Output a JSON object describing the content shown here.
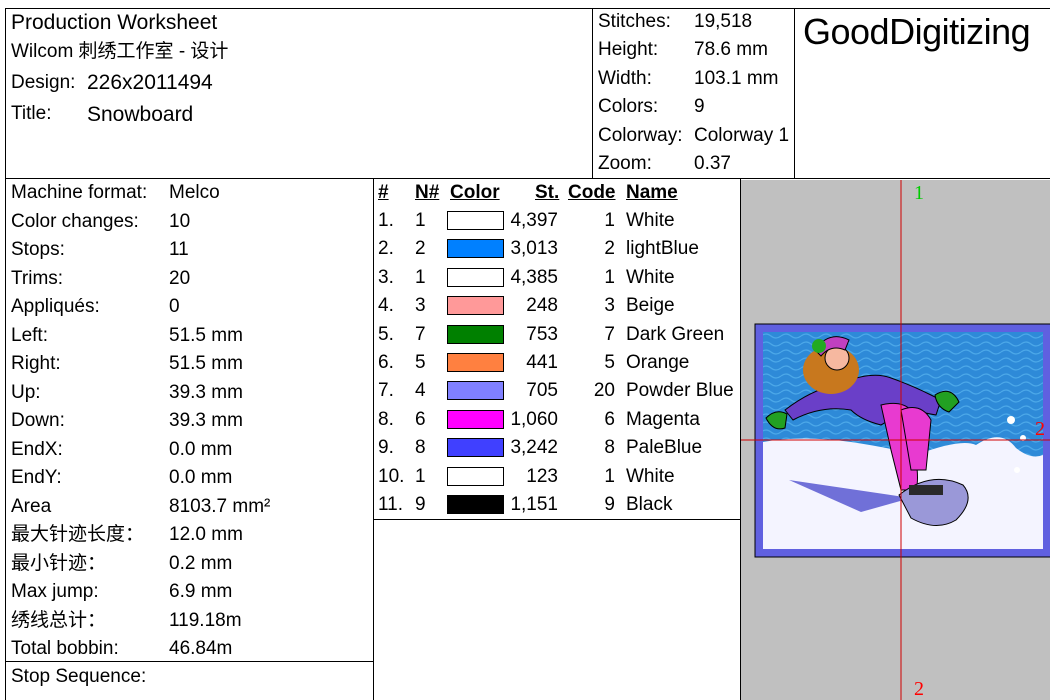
{
  "header": {
    "title": "Production Worksheet",
    "software": "Wilcom 刺绣工作室 - 设计",
    "design_label": "Design:",
    "design_value": "226x2011494",
    "title_label": "Title:",
    "title_value": "Snowboard"
  },
  "stats": [
    {
      "label": "Stitches:",
      "value": "19,518"
    },
    {
      "label": "Height:",
      "value": "78.6 mm"
    },
    {
      "label": "Width:",
      "value": "103.1 mm"
    },
    {
      "label": "Colors:",
      "value": "9"
    },
    {
      "label": "Colorway:",
      "value": "Colorway 1"
    },
    {
      "label": "Zoom:",
      "value": "0.37"
    }
  ],
  "brand": "GoodDigitizing",
  "machine": [
    {
      "label": "Machine format:",
      "value": "Melco"
    },
    {
      "label": "Color changes:",
      "value": "10"
    },
    {
      "label": "Stops:",
      "value": "11"
    },
    {
      "label": "Trims:",
      "value": "20"
    },
    {
      "label": "Appliqués:",
      "value": "0"
    },
    {
      "label": "Left:",
      "value": "51.5 mm"
    },
    {
      "label": "Right:",
      "value": "51.5 mm"
    },
    {
      "label": "Up:",
      "value": "39.3 mm"
    },
    {
      "label": "Down:",
      "value": "39.3 mm"
    },
    {
      "label": "EndX:",
      "value": "0.0 mm"
    },
    {
      "label": "EndY:",
      "value": "0.0 mm"
    },
    {
      "label": "Area",
      "value": "8103.7 mm²"
    },
    {
      "label": "最大针迹长度：",
      "value": "12.0 mm"
    },
    {
      "label": "最小针迹：",
      "value": "0.2 mm"
    },
    {
      "label": "Max jump:",
      "value": "6.9 mm"
    },
    {
      "label": "绣线总计：",
      "value": "119.18m"
    },
    {
      "label": "Total bobbin:",
      "value": "46.84m"
    }
  ],
  "stop_sequence_label": "Stop Sequence:",
  "color_table": {
    "headers": {
      "num": "#",
      "needle": "N#",
      "color": "Color",
      "stitches": "St.",
      "code": "Code",
      "name": "Name"
    },
    "rows": [
      {
        "num": "1.",
        "needle": "1",
        "color": "#ffffff",
        "stitches": "4,397",
        "code": "1",
        "name": "White"
      },
      {
        "num": "2.",
        "needle": "2",
        "color": "#0080ff",
        "stitches": "3,013",
        "code": "2",
        "name": "lightBlue"
      },
      {
        "num": "3.",
        "needle": "1",
        "color": "#ffffff",
        "stitches": "4,385",
        "code": "1",
        "name": "White"
      },
      {
        "num": "4.",
        "needle": "3",
        "color": "#ff9999",
        "stitches": "248",
        "code": "3",
        "name": "Beige"
      },
      {
        "num": "5.",
        "needle": "7",
        "color": "#008000",
        "stitches": "753",
        "code": "7",
        "name": "Dark Green"
      },
      {
        "num": "6.",
        "needle": "5",
        "color": "#ff8040",
        "stitches": "441",
        "code": "5",
        "name": "Orange"
      },
      {
        "num": "7.",
        "needle": "4",
        "color": "#8080ff",
        "stitches": "705",
        "code": "20",
        "name": "Powder Blue"
      },
      {
        "num": "8.",
        "needle": "6",
        "color": "#ff00ff",
        "stitches": "1,060",
        "code": "6",
        "name": "Magenta"
      },
      {
        "num": "9.",
        "needle": "8",
        "color": "#4040ff",
        "stitches": "3,242",
        "code": "8",
        "name": "PaleBlue"
      },
      {
        "num": "10.",
        "needle": "1",
        "color": "#ffffff",
        "stitches": "123",
        "code": "1",
        "name": "White"
      },
      {
        "num": "11.",
        "needle": "9",
        "color": "#000000",
        "stitches": "1,151",
        "code": "9",
        "name": "Black"
      }
    ]
  },
  "preview": {
    "marker_top": "1",
    "marker_right": "2",
    "marker_bottom": "2",
    "marker_color_top": "#00cc00",
    "marker_color_other": "#ff0000"
  }
}
